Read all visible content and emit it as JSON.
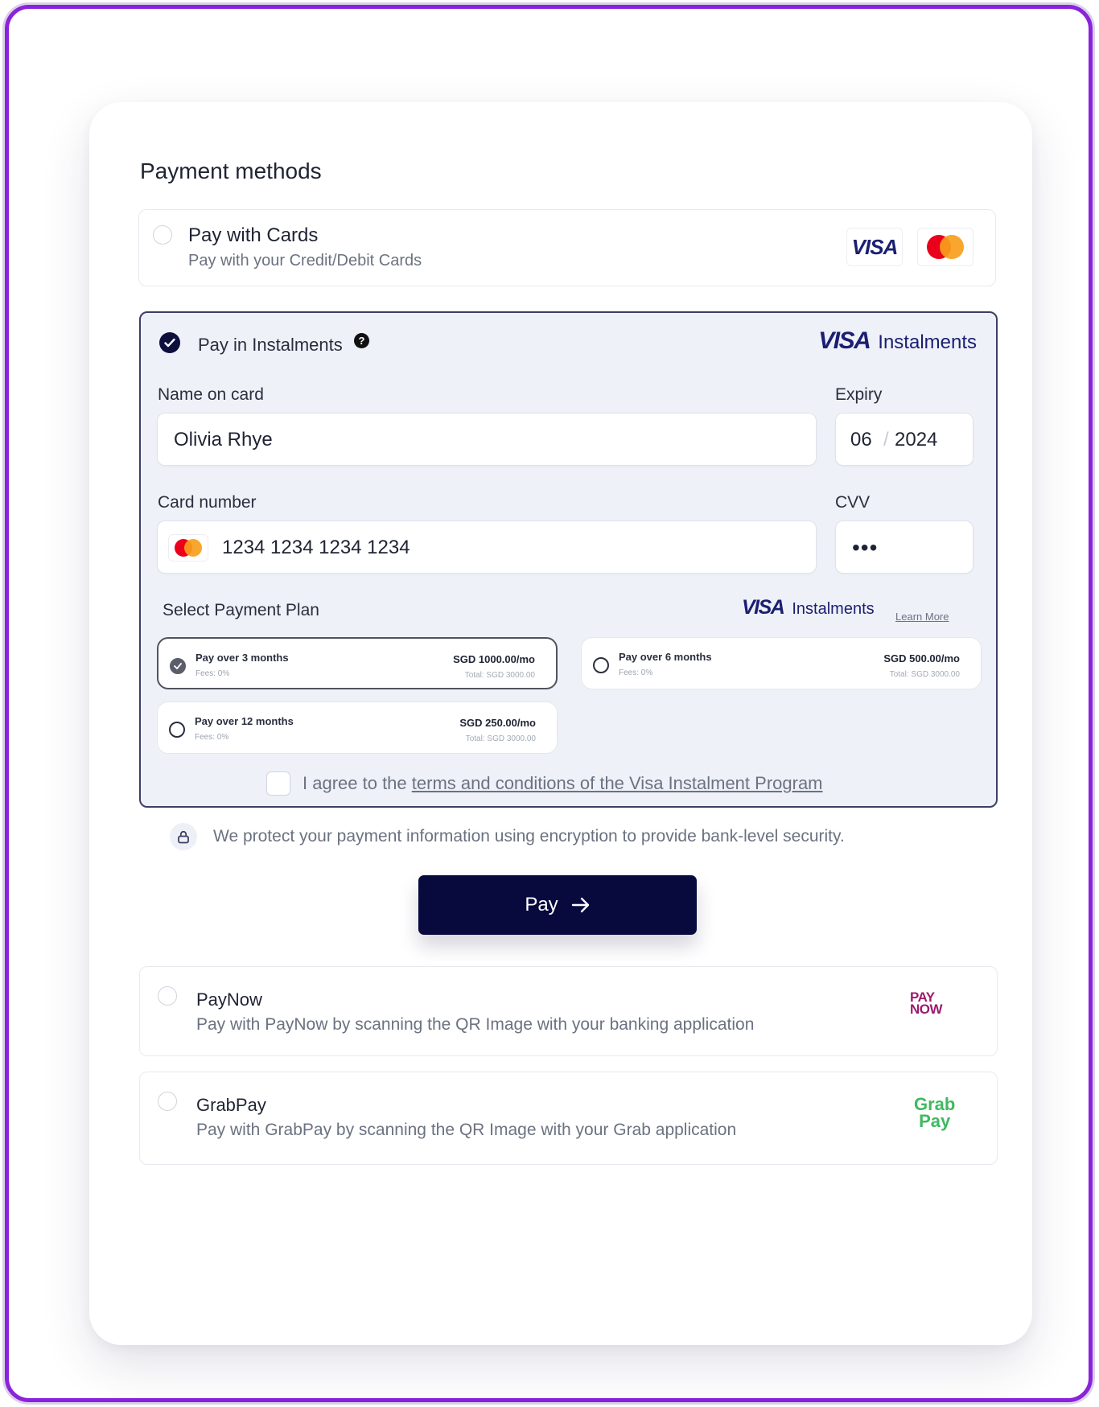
{
  "title": "Payment methods",
  "cards_option": {
    "title": "Pay with Cards",
    "subtitle": "Pay with your Credit/Debit Cards",
    "visa_badge": "VISA"
  },
  "instalments": {
    "title": "Pay in Instalments",
    "help_glyph": "?",
    "logo_visa": "VISA",
    "logo_text": "Instalments",
    "name_label": "Name on card",
    "name_value": "Olivia Rhye",
    "expiry_label": "Expiry",
    "expiry_month": "06",
    "expiry_sep": "/",
    "expiry_year": "2024",
    "card_label": "Card number",
    "card_value": "1234 1234 1234 1234",
    "cvv_label": "CVV",
    "cvv_value": "•••",
    "plan_label": "Select Payment Plan",
    "learn_more": "Learn More",
    "plans": [
      {
        "title": "Pay over 3 months",
        "fees": "Fees: 0%",
        "amount": "SGD 1000.00/mo",
        "total": "Total: SGD 3000.00",
        "selected": true
      },
      {
        "title": "Pay over 6 months",
        "fees": "Fees: 0%",
        "amount": "SGD 500.00/mo",
        "total": "Total: SGD 3000.00",
        "selected": false
      },
      {
        "title": "Pay over 12 months",
        "fees": "Fees: 0%",
        "amount": "SGD 250.00/mo",
        "total": "Total: SGD 3000.00",
        "selected": false
      }
    ],
    "agree_prefix": "I agree to the ",
    "agree_link": "terms and conditions of the Visa Instalment Program"
  },
  "security_note": "We protect your payment information using encryption to provide bank-level security.",
  "pay_button": "Pay",
  "paynow": {
    "title": "PayNow",
    "subtitle": "Pay with PayNow by scanning the QR Image with your banking application",
    "logo_top": "PAY",
    "logo_bottom": "NOW"
  },
  "grabpay": {
    "title": "GrabPay",
    "subtitle": "Pay with GrabPay by scanning the QR Image with your Grab application",
    "logo_top": "Grab",
    "logo_bottom": "Pay"
  },
  "colors": {
    "frame_border": "#8a23dc",
    "brand_navy": "#080a3e",
    "visa_blue": "#1a1f71",
    "mastercard_red": "#eb001b",
    "mastercard_orange": "#f79e1b",
    "paynow_magenta": "#9c1b6e",
    "grab_green": "#3fb95f"
  }
}
